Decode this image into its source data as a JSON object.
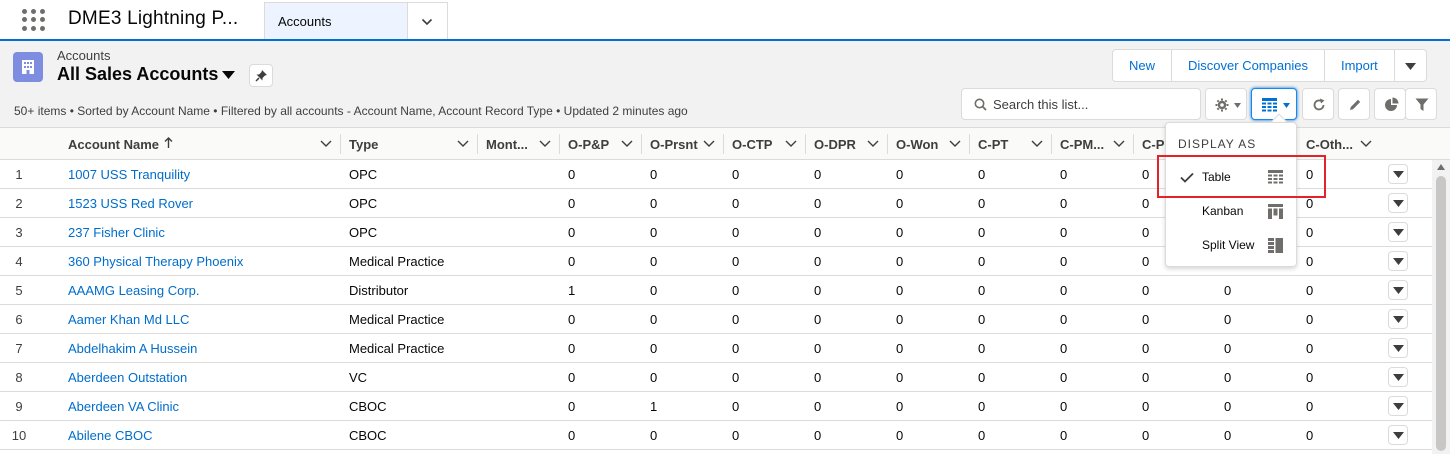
{
  "app": {
    "name": "DME3 Lightning P..."
  },
  "nav": {
    "tab_label": "Accounts"
  },
  "header": {
    "object_type": "Accounts",
    "list_title": "All Sales Accounts",
    "info": "50+ items • Sorted by Account Name • Filtered by all accounts - Account Name, Account Record Type • Updated 2 minutes ago"
  },
  "actions": {
    "new": "New",
    "discover": "Discover Companies",
    "import": "Import"
  },
  "search": {
    "placeholder": "Search this list..."
  },
  "columns": [
    "Account Name",
    "Type",
    "Mont...",
    "O-P&P",
    "O-Prsnt",
    "O-CTP",
    "O-DPR",
    "O-Won",
    "C-PT",
    "C-PM...",
    "C-Pl",
    "C-Oth..."
  ],
  "rows": [
    {
      "n": "1",
      "name": "1007 USS Tranquility",
      "type": "OPC",
      "v": [
        "0",
        "0",
        "0",
        "0",
        "0",
        "0",
        "0",
        "0",
        "",
        "0"
      ]
    },
    {
      "n": "2",
      "name": "1523 USS Red Rover",
      "type": "OPC",
      "v": [
        "0",
        "0",
        "0",
        "0",
        "0",
        "0",
        "0",
        "0",
        "",
        "0"
      ]
    },
    {
      "n": "3",
      "name": "237 Fisher Clinic",
      "type": "OPC",
      "v": [
        "0",
        "0",
        "0",
        "0",
        "0",
        "0",
        "0",
        "0",
        "",
        "0"
      ]
    },
    {
      "n": "4",
      "name": "360 Physical Therapy Phoenix",
      "type": "Medical Practice",
      "v": [
        "0",
        "0",
        "0",
        "0",
        "0",
        "0",
        "0",
        "0",
        "",
        "0"
      ]
    },
    {
      "n": "5",
      "name": "AAAMG Leasing Corp.",
      "type": "Distributor",
      "v": [
        "1",
        "0",
        "0",
        "0",
        "0",
        "0",
        "0",
        "0",
        "0",
        "0"
      ]
    },
    {
      "n": "6",
      "name": "Aamer Khan Md LLC",
      "type": "Medical Practice",
      "v": [
        "0",
        "0",
        "0",
        "0",
        "0",
        "0",
        "0",
        "0",
        "0",
        "0"
      ]
    },
    {
      "n": "7",
      "name": "Abdelhakim A Hussein",
      "type": "Medical Practice",
      "v": [
        "0",
        "0",
        "0",
        "0",
        "0",
        "0",
        "0",
        "0",
        "0",
        "0"
      ]
    },
    {
      "n": "8",
      "name": "Aberdeen Outstation",
      "type": "VC",
      "v": [
        "0",
        "0",
        "0",
        "0",
        "0",
        "0",
        "0",
        "0",
        "0",
        "0"
      ]
    },
    {
      "n": "9",
      "name": "Aberdeen VA Clinic",
      "type": "CBOC",
      "v": [
        "0",
        "1",
        "0",
        "0",
        "0",
        "0",
        "0",
        "0",
        "0",
        "0"
      ]
    },
    {
      "n": "10",
      "name": "Abilene CBOC",
      "type": "CBOC",
      "v": [
        "0",
        "0",
        "0",
        "0",
        "0",
        "0",
        "0",
        "0",
        "0",
        "0"
      ]
    }
  ],
  "menu": {
    "header": "DISPLAY AS",
    "items": [
      {
        "label": "Table",
        "selected": true,
        "icon": "table-icon"
      },
      {
        "label": "Kanban",
        "selected": false,
        "icon": "kanban-icon"
      },
      {
        "label": "Split View",
        "selected": false,
        "icon": "split-view-icon"
      }
    ]
  },
  "colors": {
    "brand": "#0070d2",
    "link": "#006dcc",
    "highlight": "#e3222a",
    "object_icon": "#7f8de1"
  }
}
